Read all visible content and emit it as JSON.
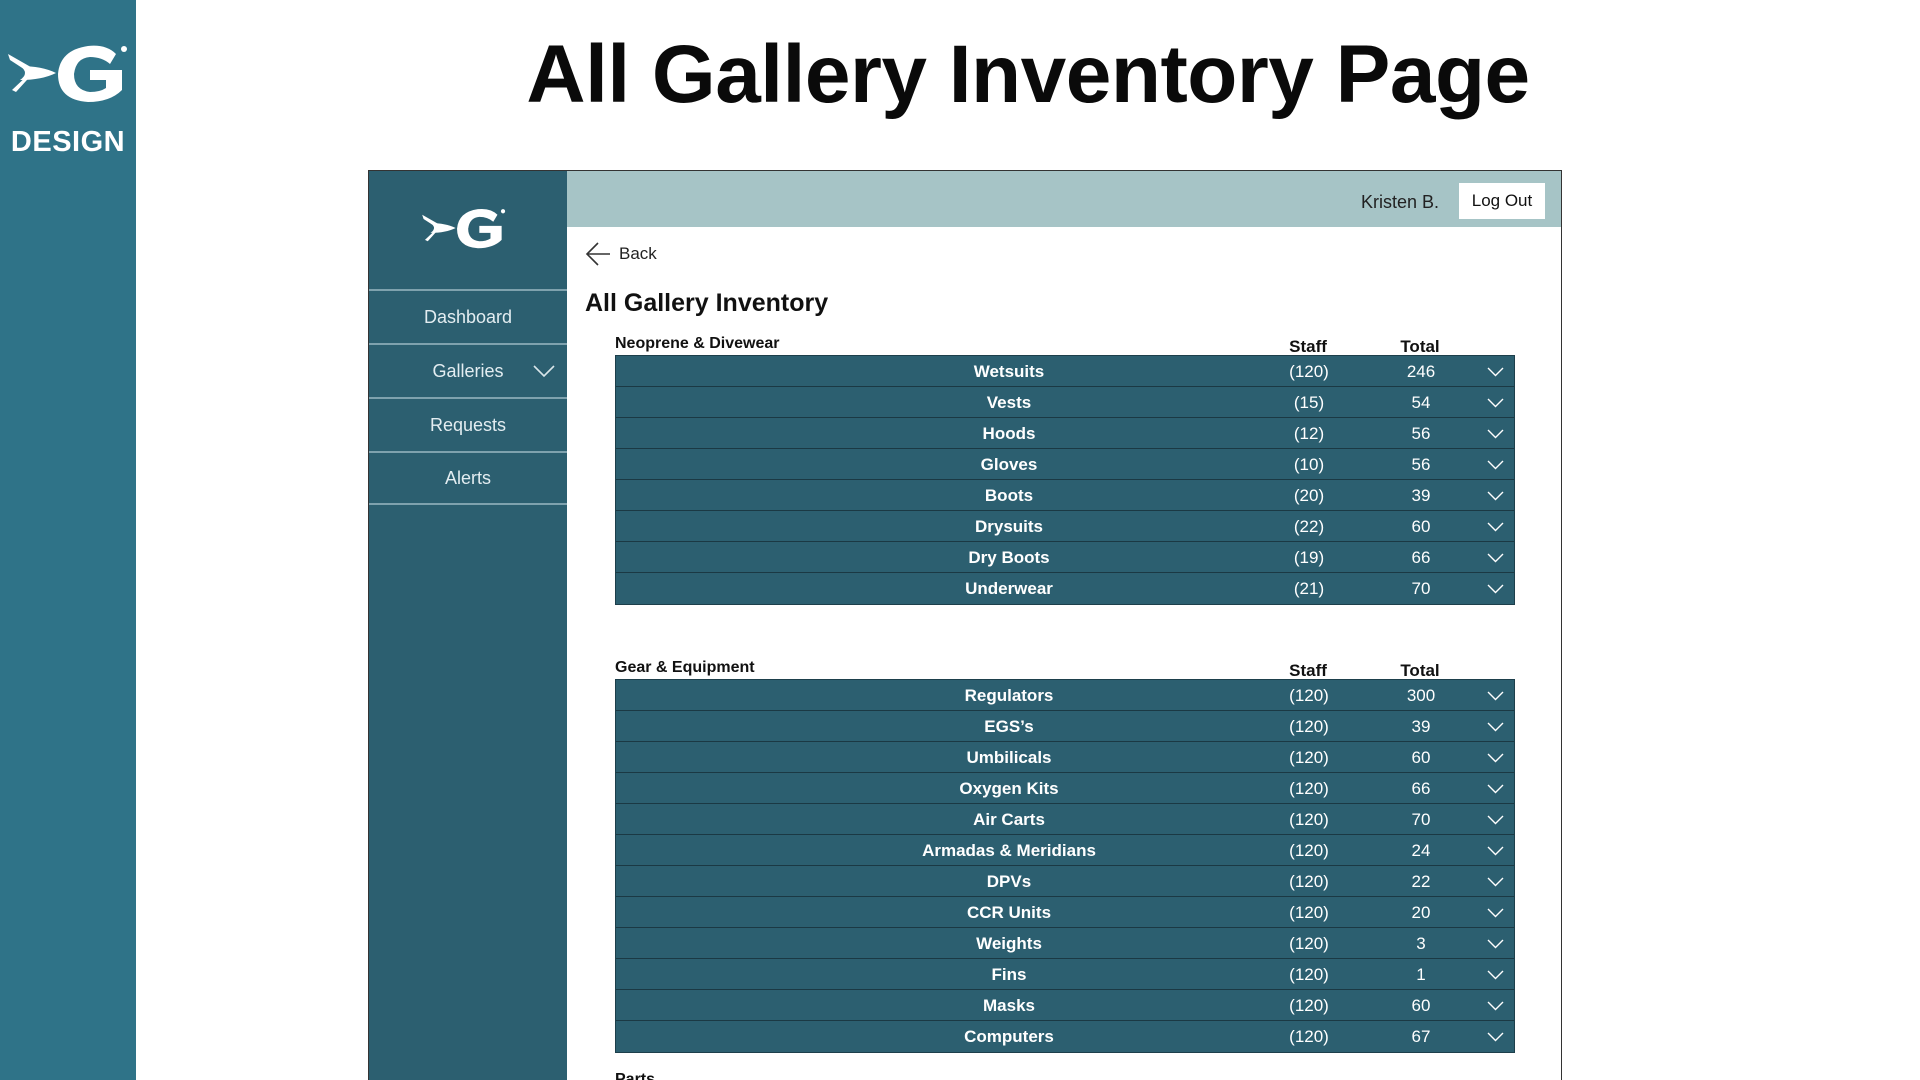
{
  "slide": {
    "brand_label": "DESIGN",
    "title": "All Gallery Inventory Page"
  },
  "colors": {
    "brand_strip": "#2f7388",
    "sidebar": "#2c5f70",
    "topbar": "#a6c4c6",
    "row": "#2c5f70"
  },
  "icons": {
    "brand_logo": "xg-logo-icon",
    "back": "arrow-left-icon",
    "expand": "chevron-down-icon"
  },
  "header": {
    "user_name": "Kristen B.",
    "logout_label": "Log Out"
  },
  "sidebar": {
    "items": [
      {
        "label": "Dashboard"
      },
      {
        "label": "Galleries"
      },
      {
        "label": "Requests"
      },
      {
        "label": "Alerts"
      }
    ]
  },
  "main": {
    "back_label": "Back",
    "title": "All Gallery Inventory",
    "sections": [
      {
        "name": "Neoprene & Divewear",
        "staff_header": "Staff",
        "total_header": "Total",
        "rows": [
          {
            "name": "Wetsuits",
            "staff": "(120)",
            "total": "246"
          },
          {
            "name": "Vests",
            "staff": "(15)",
            "total": "54"
          },
          {
            "name": "Hoods",
            "staff": "(12)",
            "total": "56"
          },
          {
            "name": "Gloves",
            "staff": "(10)",
            "total": "56"
          },
          {
            "name": "Boots",
            "staff": "(20)",
            "total": "39"
          },
          {
            "name": "Drysuits",
            "staff": "(22)",
            "total": "60"
          },
          {
            "name": "Dry Boots",
            "staff": "(19)",
            "total": "66"
          },
          {
            "name": "Underwear",
            "staff": "(21)",
            "total": "70"
          }
        ]
      },
      {
        "name": "Gear & Equipment",
        "staff_header": "Staff",
        "total_header": "Total",
        "rows": [
          {
            "name": "Regulators",
            "staff": "(120)",
            "total": "300"
          },
          {
            "name": "EGS’s",
            "staff": "(120)",
            "total": "39"
          },
          {
            "name": "Umbilicals",
            "staff": "(120)",
            "total": "60"
          },
          {
            "name": "Oxygen Kits",
            "staff": "(120)",
            "total": "66"
          },
          {
            "name": "Air Carts",
            "staff": "(120)",
            "total": "70"
          },
          {
            "name": "Armadas & Meridians",
            "staff": "(120)",
            "total": "24"
          },
          {
            "name": "DPVs",
            "staff": "(120)",
            "total": "22"
          },
          {
            "name": "CCR Units",
            "staff": "(120)",
            "total": "20"
          },
          {
            "name": "Weights",
            "staff": "(120)",
            "total": "3"
          },
          {
            "name": "Fins",
            "staff": "(120)",
            "total": "1"
          },
          {
            "name": "Masks",
            "staff": "(120)",
            "total": "60"
          },
          {
            "name": "Computers",
            "staff": "(120)",
            "total": "67"
          }
        ]
      }
    ],
    "next_section_label": "Parts"
  }
}
